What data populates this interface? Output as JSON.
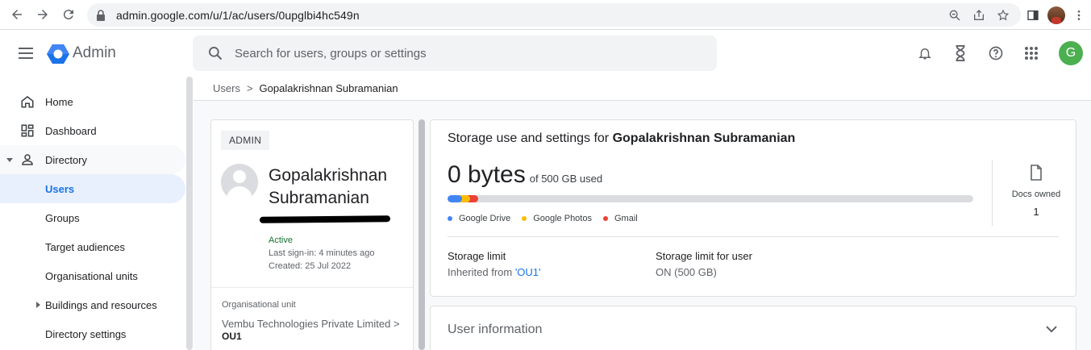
{
  "browser": {
    "url": "admin.google.com/u/1/ac/users/0upglbi4hc549n"
  },
  "header": {
    "app_name": "Admin",
    "search_placeholder": "Search for users, groups or settings",
    "avatar_letter": "G",
    "avatar_color": "#4caf50"
  },
  "sidebar": {
    "items": [
      {
        "label": "Home",
        "icon": "home-icon"
      },
      {
        "label": "Dashboard",
        "icon": "dashboard-icon"
      },
      {
        "label": "Directory",
        "icon": "person-icon",
        "expanded": true
      },
      {
        "label": "Users",
        "active": true
      },
      {
        "label": "Groups"
      },
      {
        "label": "Target audiences"
      },
      {
        "label": "Organisational units"
      },
      {
        "label": "Buildings and resources",
        "collapsed_caret": true
      },
      {
        "label": "Directory settings"
      }
    ]
  },
  "breadcrumb": {
    "parent": "Users",
    "separator": ">",
    "current": "Gopalakrishnan Subramanian"
  },
  "user_card": {
    "role_chip": "ADMIN",
    "name": "Gopalakrishnan Subramanian",
    "status": "Active",
    "last_signin": "Last sign-in: 4 minutes ago",
    "created": "Created: 25 Jul 2022",
    "ou_label": "Organisational unit",
    "ou_path": "Vembu Technologies Private Limited  >",
    "ou_leaf": "OU1"
  },
  "storage": {
    "title_prefix": "Storage use and settings for ",
    "title_name": "Gopalakrishnan Subramanian",
    "used": "0 bytes",
    "used_of": "of 500 GB used",
    "used_fraction": 0,
    "legend": [
      {
        "label": "Google Drive",
        "color": "#4285f4"
      },
      {
        "label": "Google Photos",
        "color": "#fbbc04"
      },
      {
        "label": "Gmail",
        "color": "#ea4335"
      }
    ],
    "docs_label": "Docs owned",
    "docs_count": "1",
    "limit_head": "Storage limit",
    "limit_prefix": "Inherited from ",
    "limit_link": "'OU1'",
    "user_limit_head": "Storage limit for user",
    "user_limit_value": "ON (500 GB)"
  },
  "info_card": {
    "title": "User information"
  }
}
